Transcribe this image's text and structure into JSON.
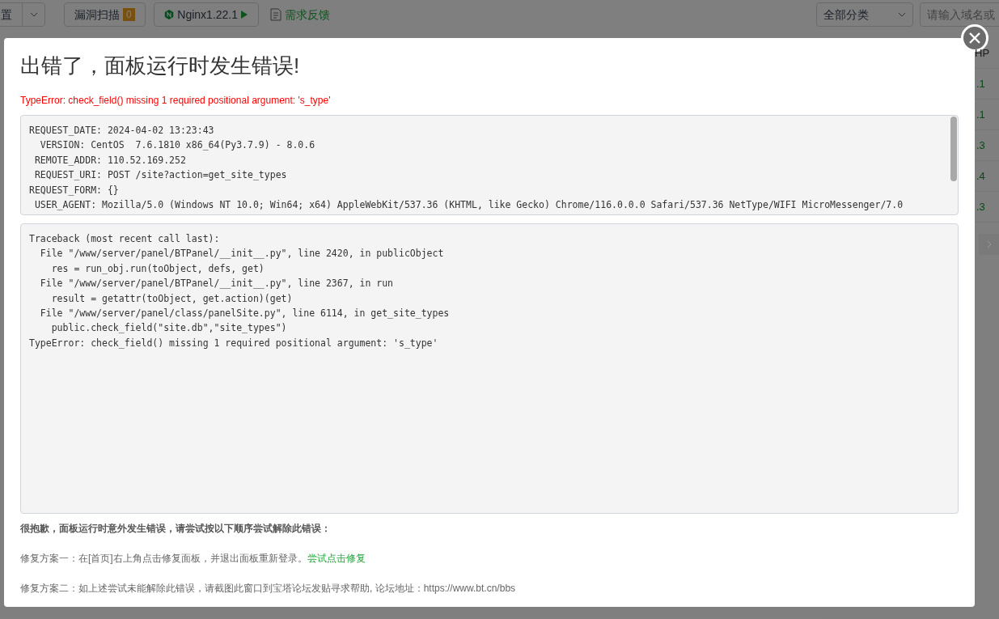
{
  "toolbar": {
    "settings_button": "置",
    "scan_button": {
      "label": "漏洞扫描",
      "badge": "0"
    },
    "server_button": {
      "label": "Nginx1.22.1"
    },
    "feedback_link": "需求反馈",
    "category_select": "全部分类",
    "search": {
      "placeholder": "请输入域名或"
    }
  },
  "table": {
    "column_header": "HP",
    "rows": [
      {
        "cell": ".1"
      },
      {
        "cell": ".1"
      },
      {
        "cell": ".3"
      },
      {
        "cell": ".4"
      },
      {
        "cell": ".3"
      }
    ]
  },
  "dialog": {
    "title": "出错了，面板运行时发生错误!",
    "error": "TypeError: check_field() missing 1 required positional argument: 's_type'",
    "request_info": [
      "REQUEST_DATE: 2024-04-02 13:23:43",
      "  VERSION: CentOS  7.6.1810 x86_64(Py3.7.9) - 8.0.6",
      " REMOTE_ADDR: 110.52.169.252",
      " REQUEST_URI: POST /site?action=get_site_types",
      "REQUEST_FORM: {}",
      " USER_AGENT: Mozilla/5.0 (Windows NT 10.0; Win64; x64) AppleWebKit/537.36 (KHTML, like Gecko) Chrome/116.0.0.0 Safari/537.36 NetType/WIFI MicroMessenger/7.0"
    ],
    "traceback": [
      "Traceback (most recent call last):",
      "  File \"/www/server/panel/BTPanel/__init__.py\", line 2420, in publicObject",
      "    res = run_obj.run(toObject, defs, get)",
      "  File \"/www/server/panel/BTPanel/__init__.py\", line 2367, in run",
      "    result = getattr(toObject, get.action)(get)",
      "  File \"/www/server/panel/class/panelSite.py\", line 6114, in get_site_types",
      "    public.check_field(\"site.db\",\"site_types\")",
      "TypeError: check_field() missing 1 required positional argument: 's_type'"
    ],
    "apology": "很抱歉，面板运行时意外发生错误，请尝试按以下顺序尝试解除此错误：",
    "fix_one": {
      "text": "修复方案一：在[首页]右上角点击修复面板，并退出面板重新登录。",
      "link": "尝试点击修复"
    },
    "fix_two": "修复方案二：如上述尝试未能解除此错误，请截图此窗口到宝塔论坛发贴寻求帮助, 论坛地址：https://www.bt.cn/bbs"
  }
}
